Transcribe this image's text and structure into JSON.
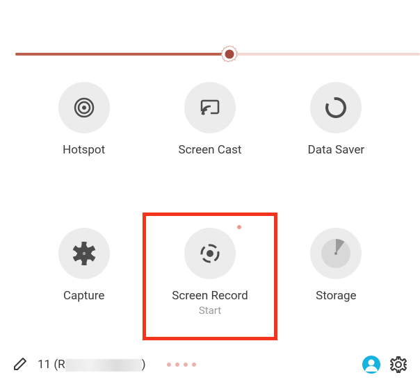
{
  "brightness": {
    "percent": 53,
    "track_color": "#f3d9d4",
    "fill_color": "#bb5f4e",
    "thumb_fill": "#a24a3b",
    "thumb_outline": "#d7a296"
  },
  "tiles": [
    {
      "id": "hotspot",
      "label": "Hotspot",
      "sub": "",
      "icon": "hotspot-icon"
    },
    {
      "id": "screen-cast",
      "label": "Screen Cast",
      "sub": "",
      "icon": "cast-icon"
    },
    {
      "id": "data-saver",
      "label": "Data Saver",
      "sub": "",
      "icon": "data-saver-icon"
    },
    {
      "id": "capture",
      "label": "Capture",
      "sub": "",
      "icon": "aperture-icon"
    },
    {
      "id": "screen-record",
      "label": "Screen Record",
      "sub": "Start",
      "icon": "record-icon",
      "recording_indicator": true
    },
    {
      "id": "storage",
      "label": "Storage",
      "sub": "",
      "icon": "storage-pie-icon"
    }
  ],
  "highlight": {
    "target": "screen-record",
    "color": "#f4341c"
  },
  "footer": {
    "version_prefix": "11 (R",
    "version_suffix": ")",
    "page_dots": 4,
    "avatar_color": "#17b3e0",
    "gear_color": "#3a3a3a"
  }
}
